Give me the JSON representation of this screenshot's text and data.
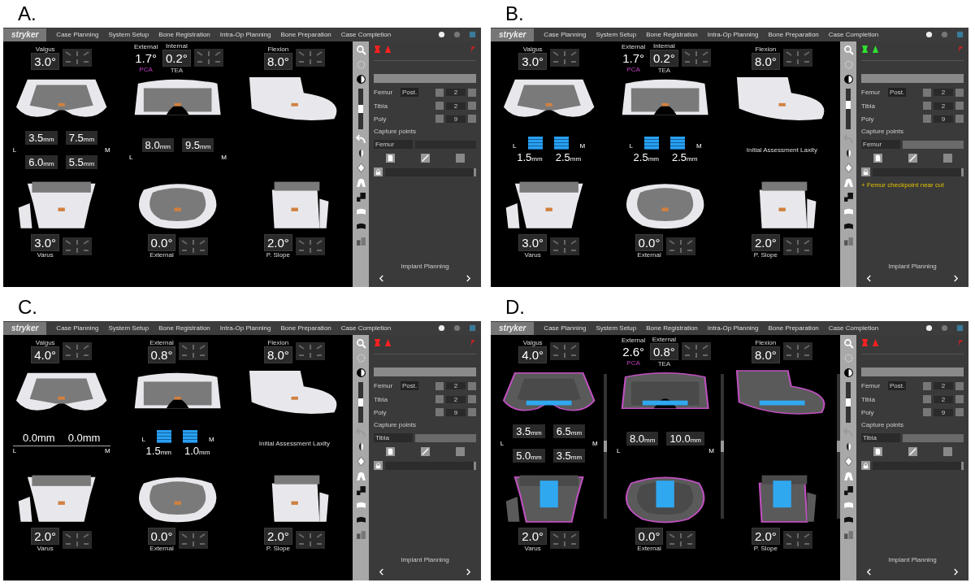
{
  "panels": [
    {
      "label": "A.",
      "logo": "stryker",
      "menu": [
        "Case Planning",
        "System Setup",
        "Bone Registration",
        "Intra-Op Planning",
        "Bone Preparation",
        "Case Completion"
      ],
      "ct_overlay": false,
      "scrollbars": false,
      "top": [
        {
          "readouts": [
            {
              "caption": "Valgus",
              "value": "3.0°",
              "boxed": true
            }
          ]
        },
        {
          "readouts": [
            {
              "caption": "External",
              "value": "1.7°",
              "boxed": false,
              "note": "PCA"
            },
            {
              "caption": "Internal",
              "value": "0.2°",
              "boxed": true,
              "note": "TEA"
            }
          ]
        },
        {
          "readouts": [
            {
              "caption": "Flexion",
              "value": "8.0°",
              "boxed": true
            }
          ]
        }
      ],
      "middle": [
        {
          "kind": "gaps",
          "left": "L",
          "right": "M",
          "rows": [
            [
              {
                "value": "3.5",
                "unit": "mm"
              },
              {
                "value": "7.5",
                "unit": "mm"
              }
            ],
            [
              {
                "value": "6.0",
                "unit": "mm"
              },
              {
                "value": "5.5",
                "unit": "mm"
              }
            ]
          ]
        },
        {
          "kind": "gaps",
          "left": "L",
          "right": "M",
          "rows": [
            [
              {
                "value": "8.0",
                "unit": "mm"
              },
              {
                "value": "9.5",
                "unit": "mm"
              }
            ]
          ]
        },
        {
          "kind": "empty"
        }
      ],
      "bottom": [
        {
          "value": "3.0°",
          "caption": "Varus"
        },
        {
          "value": "0.0°",
          "caption": "External"
        },
        {
          "value": "2.0°",
          "caption": "P. Slope"
        }
      ],
      "tools": {
        "slider": {
          "level": 0.5
        },
        "undo_enabled": true
      },
      "side": {
        "implants_done": false,
        "rows": [
          {
            "label": "Femur",
            "option": "Post.",
            "value": "2"
          },
          {
            "label": "Tibia",
            "value": "2"
          },
          {
            "label": "Poly",
            "value": "9"
          }
        ],
        "capture_title": "Capture points",
        "capture": "Femur",
        "capture_button": false,
        "footer": "Implant Planning"
      }
    },
    {
      "label": "B.",
      "logo": "stryker",
      "menu": [
        "Case Planning",
        "System Setup",
        "Bone Registration",
        "Intra-Op Planning",
        "Bone Preparation",
        "Case Completion"
      ],
      "ct_overlay": false,
      "scrollbars": false,
      "top": [
        {
          "readouts": [
            {
              "caption": "Valgus",
              "value": "3.0°",
              "boxed": true
            }
          ]
        },
        {
          "readouts": [
            {
              "caption": "External",
              "value": "1.7°",
              "boxed": false,
              "note": "PCA"
            },
            {
              "caption": "Internal",
              "value": "0.2°",
              "boxed": true,
              "note": "TEA"
            }
          ]
        },
        {
          "readouts": [
            {
              "caption": "Flexion",
              "value": "8.0°",
              "boxed": true
            }
          ]
        }
      ],
      "middle": [
        {
          "kind": "bars",
          "left": "L",
          "right": "M",
          "bars": [
            {
              "value": "1.5",
              "unit": "mm"
            },
            {
              "value": "2.5",
              "unit": "mm"
            }
          ]
        },
        {
          "kind": "bars",
          "left": "L",
          "right": "M",
          "bars": [
            {
              "value": "2.5",
              "unit": "mm"
            },
            {
              "value": "2.5",
              "unit": "mm"
            }
          ]
        },
        {
          "kind": "text",
          "text": "Initial Assessment Laxity"
        }
      ],
      "bottom": [
        {
          "value": "3.0°",
          "caption": "Varus"
        },
        {
          "value": "0.0°",
          "caption": "External"
        },
        {
          "value": "2.0°",
          "caption": "P. Slope"
        }
      ],
      "tools": {
        "slider": {
          "level": 0.6
        },
        "undo_enabled": false
      },
      "side": {
        "implants_done": true,
        "rows": [
          {
            "label": "Femur",
            "option": "Post.",
            "value": "2"
          },
          {
            "label": "Tibia",
            "value": "2"
          },
          {
            "label": "Poly",
            "value": "9"
          }
        ],
        "capture_title": "Capture points",
        "capture": "Femur",
        "capture_button": true,
        "note": "+ Femur checkpoint near cut",
        "footer": "Implant Planning"
      }
    },
    {
      "label": "C.",
      "logo": "stryker",
      "menu": [
        "Case Planning",
        "System Setup",
        "Bone Registration",
        "Intra-Op Planning",
        "Bone Preparation",
        "Case Completion"
      ],
      "ct_overlay": false,
      "scrollbars": false,
      "top": [
        {
          "readouts": [
            {
              "caption": "Valgus",
              "value": "4.0°",
              "boxed": true
            }
          ]
        },
        {
          "readouts": [
            {
              "caption": "External",
              "value": "0.8°",
              "boxed": true
            }
          ]
        },
        {
          "readouts": [
            {
              "caption": "Flexion",
              "value": "8.0°",
              "boxed": true
            }
          ]
        }
      ],
      "middle": [
        {
          "kind": "line",
          "left": "L",
          "right": "M",
          "values": [
            "0.0mm",
            "0.0mm"
          ]
        },
        {
          "kind": "bars",
          "left": "L",
          "right": "M",
          "bars": [
            {
              "value": "1.5",
              "unit": "mm"
            },
            {
              "value": "1.0",
              "unit": "mm"
            }
          ]
        },
        {
          "kind": "text",
          "text": "Initial Assessment Laxity"
        }
      ],
      "bottom": [
        {
          "value": "2.0°",
          "caption": "Varus"
        },
        {
          "value": "0.0°",
          "caption": "External"
        },
        {
          "value": "2.0°",
          "caption": "P. Slope"
        }
      ],
      "tools": {
        "slider": {
          "level": 0.5
        },
        "undo_enabled": false
      },
      "side": {
        "implants_done": false,
        "rows": [
          {
            "label": "Femur",
            "option": "Post.",
            "value": "2"
          },
          {
            "label": "Tibia",
            "value": "2"
          },
          {
            "label": "Poly",
            "value": "9"
          }
        ],
        "capture_title": "Capture points",
        "capture": "Tibia",
        "capture_button": true,
        "footer": "Implant Planning"
      }
    },
    {
      "label": "D.",
      "logo": "stryker",
      "menu": [
        "Case Planning",
        "System Setup",
        "Bone Registration",
        "Intra-Op Planning",
        "Bone Preparation",
        "Case Completion"
      ],
      "ct_overlay": true,
      "scrollbars": true,
      "top": [
        {
          "readouts": [
            {
              "caption": "Valgus",
              "value": "4.0°",
              "boxed": true
            }
          ]
        },
        {
          "readouts": [
            {
              "caption": "External",
              "value": "2.6°",
              "boxed": false,
              "note": "PCA"
            },
            {
              "caption": "External",
              "value": "0.8°",
              "boxed": true,
              "note": "TEA"
            }
          ]
        },
        {
          "readouts": [
            {
              "caption": "Flexion",
              "value": "8.0°",
              "boxed": true
            }
          ]
        }
      ],
      "middle": [
        {
          "kind": "gaps",
          "left": "L",
          "right": "M",
          "rows": [
            [
              {
                "value": "3.5",
                "unit": "mm"
              },
              {
                "value": "6.5",
                "unit": "mm"
              }
            ],
            [
              {
                "value": "5.0",
                "unit": "mm"
              },
              {
                "value": "3.5",
                "unit": "mm"
              }
            ]
          ]
        },
        {
          "kind": "gaps",
          "left": "L",
          "right": "M",
          "rows": [
            [
              {
                "value": "8.0",
                "unit": "mm"
              },
              {
                "value": "10.0",
                "unit": "mm"
              }
            ]
          ]
        },
        {
          "kind": "empty"
        }
      ],
      "bottom": [
        {
          "value": "2.0°",
          "caption": "Varus"
        },
        {
          "value": "0.0°",
          "caption": "External"
        },
        {
          "value": "2.0°",
          "caption": "P. Slope"
        }
      ],
      "tools": {
        "slider": {
          "level": 0.5
        },
        "undo_enabled": false
      },
      "side": {
        "implants_done": false,
        "rows": [
          {
            "label": "Femur",
            "option": "Post.",
            "value": "2"
          },
          {
            "label": "Tibia",
            "value": "2"
          },
          {
            "label": "Poly",
            "value": "9"
          }
        ],
        "capture_title": "Capture points",
        "capture": "Tibia",
        "capture_button": true,
        "footer": "Implant Planning"
      }
    }
  ]
}
